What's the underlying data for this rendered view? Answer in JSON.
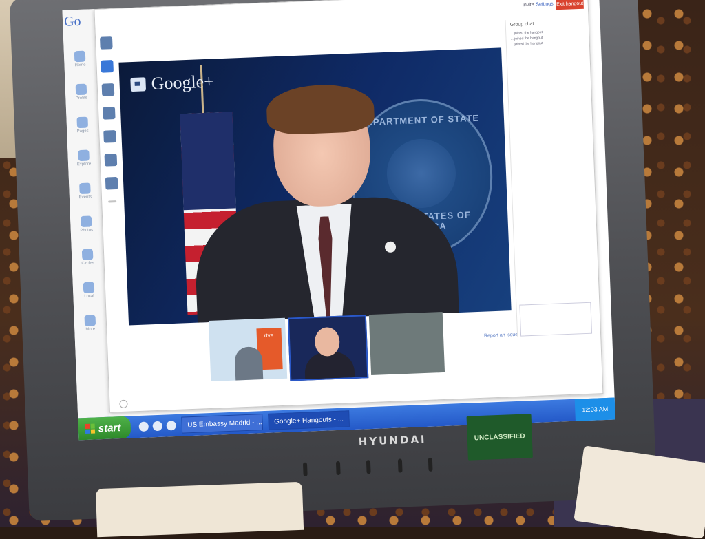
{
  "window": {
    "app": "Google+ Hangouts"
  },
  "sidebar": {
    "logo": "Go",
    "items": [
      {
        "label": "Home"
      },
      {
        "label": "Profile"
      },
      {
        "label": "Pages"
      },
      {
        "label": "Explore"
      },
      {
        "label": "Events"
      },
      {
        "label": "Photos"
      },
      {
        "label": "Circles"
      },
      {
        "label": "Local"
      },
      {
        "label": "More"
      }
    ]
  },
  "hangout": {
    "watermark": "Google+",
    "seal_top": "DEPARTMENT OF STATE",
    "seal_bottom": "UNITED STATES OF AMERICA",
    "thumb_label": "rtve",
    "buttons": {
      "invite": "Invite",
      "settings": "Settings",
      "exit": "Exit hangout"
    },
    "chat": {
      "title": "Group chat",
      "lines": [
        "... joined the hangout",
        "... joined the hangout",
        "... joined the hangout"
      ]
    },
    "report": "Report an issue"
  },
  "taskbar": {
    "start": "start",
    "tasks": [
      "US Embassy Madrid - ...",
      "Google+ Hangouts - ..."
    ],
    "clock": "12:03 AM"
  },
  "monitor": {
    "brand": "HYUNDAI",
    "sticker": "UNCLASSIFIED"
  },
  "colors": {
    "taskbar": "#2459c8",
    "start": "#2e8a2a",
    "exit": "#d9432f",
    "video_bg": "#0f2a66"
  }
}
